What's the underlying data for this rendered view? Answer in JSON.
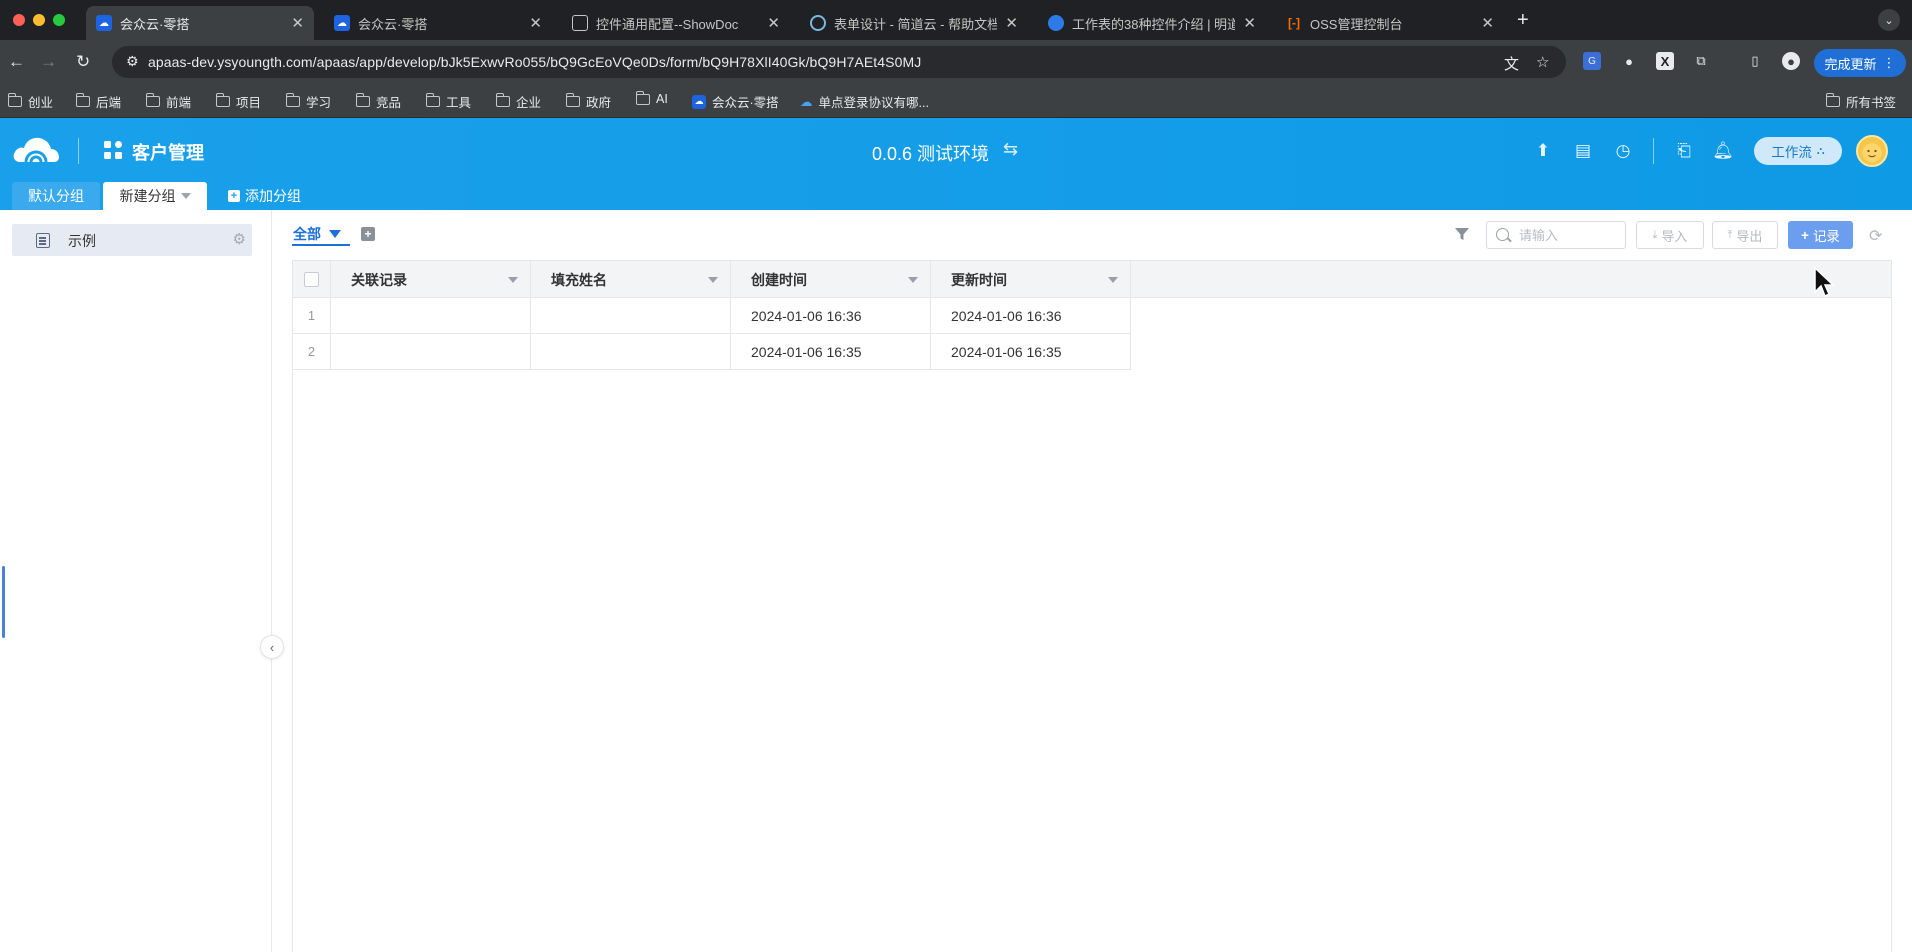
{
  "browser": {
    "tabs": [
      {
        "title": "会众云·零搭",
        "active": true
      },
      {
        "title": "会众云·零搭",
        "active": false
      },
      {
        "title": "控件通用配置--ShowDoc",
        "active": false
      },
      {
        "title": "表单设计 - 简道云 - 帮助文档",
        "active": false
      },
      {
        "title": "工作表的38种控件介绍 | 明道云",
        "active": false
      },
      {
        "title": "OSS管理控制台",
        "active": false
      }
    ],
    "url": "apaas-dev.ysyoungth.com/apaas/app/develop/bJk5ExwvRo055/bQ9GcEoVQe0Ds/form/bQ9H78XlI40Gk/bQ9H7AEt4S0MJ",
    "update_button": "完成更新",
    "bookmarks": [
      "创业",
      "后端",
      "前端",
      "项目",
      "学习",
      "竞品",
      "工具",
      "企业",
      "政府",
      "AI",
      "会众云·零搭",
      "单点登录协议有哪..."
    ],
    "all_bookmarks": "所有书签"
  },
  "app": {
    "title": "客户管理",
    "environment": "0.0.6 测试环境",
    "workflow_button": "工作流",
    "group_tabs": [
      {
        "label": "默认分组",
        "active": false
      },
      {
        "label": "新建分组",
        "active": true
      }
    ],
    "add_group": "添加分组"
  },
  "sidebar": {
    "items": [
      {
        "label": "示例"
      }
    ]
  },
  "view": {
    "tab_label": "全部",
    "search_placeholder": "请输入",
    "import_label": "导入",
    "export_label": "导出",
    "record_label": "记录"
  },
  "table": {
    "columns": [
      "关联记录",
      "填充姓名",
      "创建时间",
      "更新时间"
    ],
    "rows": [
      {
        "index": "1",
        "cells": [
          "",
          "",
          "2024-01-06 16:36",
          "2024-01-06 16:36"
        ]
      },
      {
        "index": "2",
        "cells": [
          "",
          "",
          "2024-01-06 16:35",
          "2024-01-06 16:35"
        ]
      }
    ]
  },
  "colors": {
    "header_blue": "#1aa0ea",
    "primary_blue": "#1e6fd9",
    "record_button": "#6c9ef0"
  }
}
